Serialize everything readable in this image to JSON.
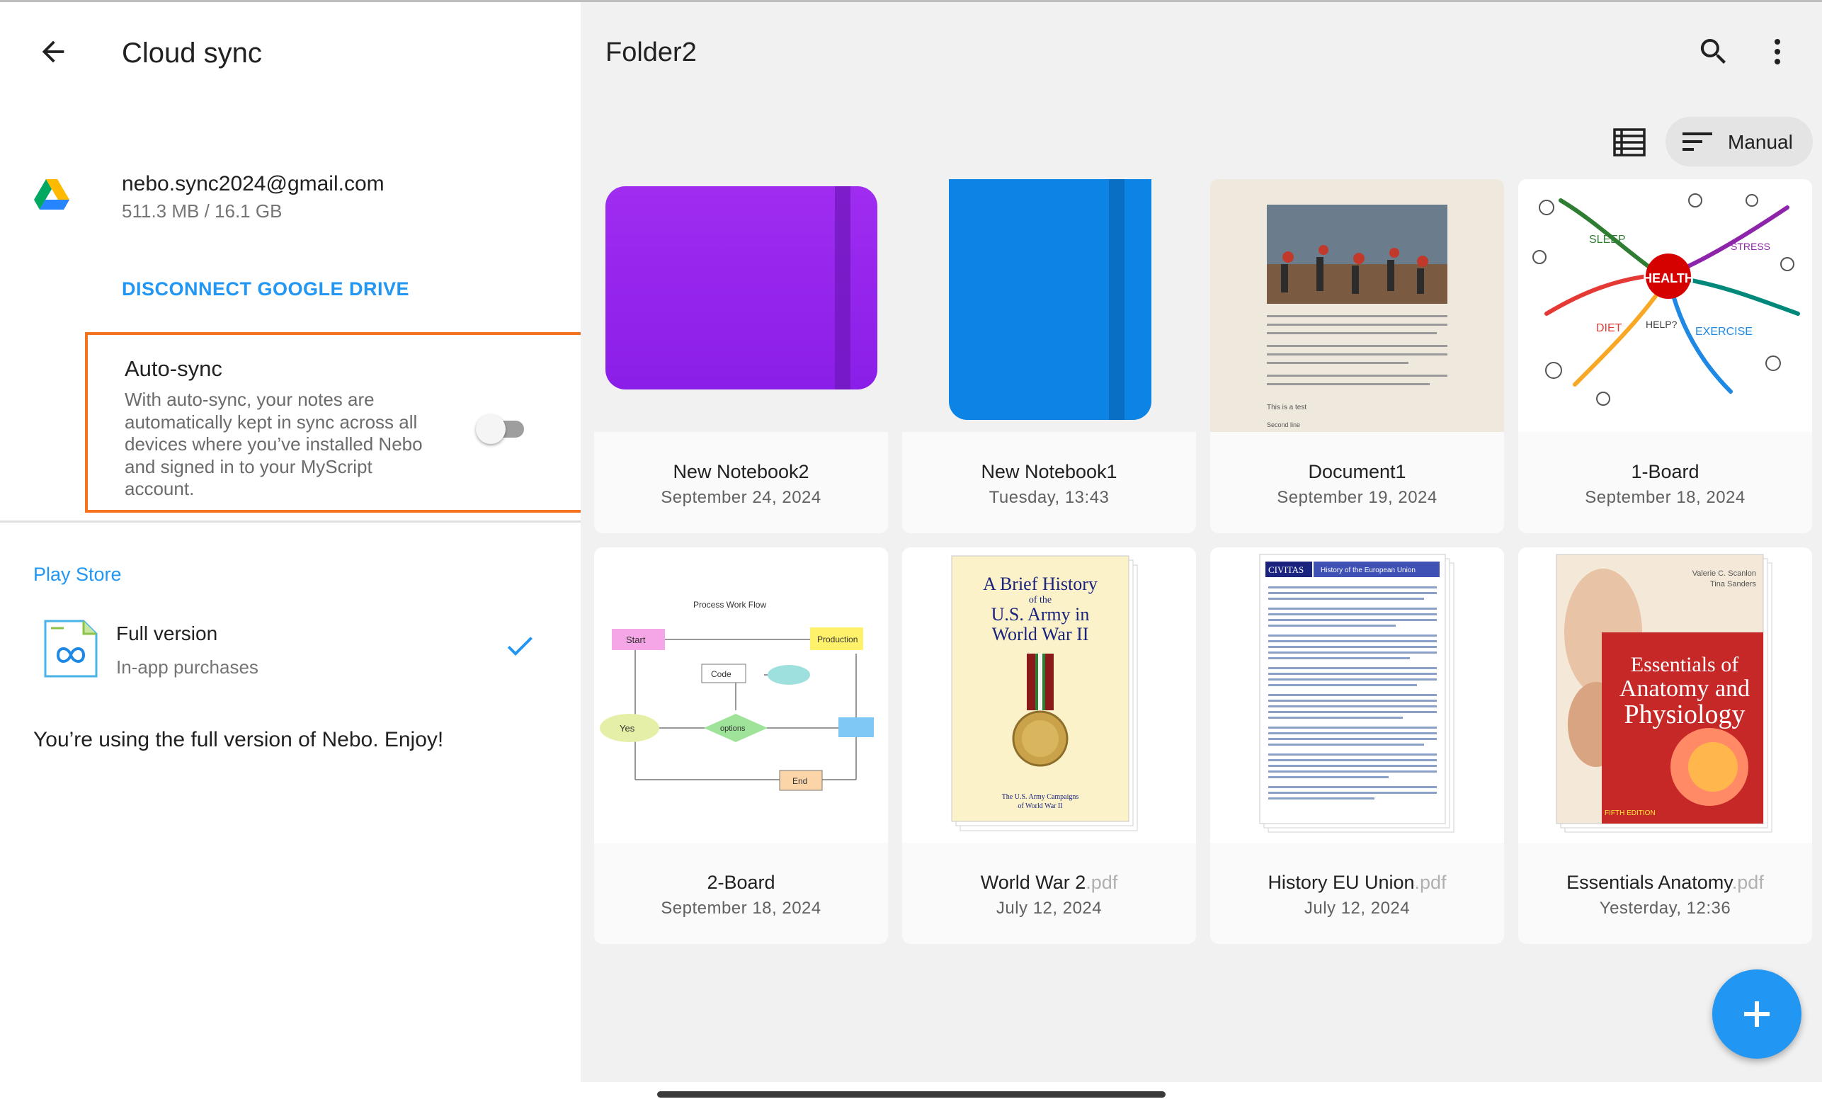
{
  "settings": {
    "title": "Cloud sync",
    "account": {
      "email": "nebo.sync2024@gmail.com",
      "usage": "511.3 MB / 16.1 GB"
    },
    "disconnect_label": "DISCONNECT GOOGLE DRIVE",
    "autosync": {
      "title": "Auto-sync",
      "description": "With auto-sync, your notes are automatically kept in sync across all devices where you’ve installed Nebo and signed in to your MyScript account.",
      "enabled": false
    },
    "store": {
      "heading": "Play Store",
      "item_title": "Full version",
      "item_subtitle": "In-app purchases",
      "message": "You’re using the full version of Nebo. Enjoy!"
    }
  },
  "folder": {
    "title": "Folder2",
    "sort_label": "Manual",
    "items": [
      {
        "name": "New Notebook2",
        "ext": "",
        "date": "September 24, 2024"
      },
      {
        "name": "New Notebook1",
        "ext": "",
        "date": "Tuesday, 13:43"
      },
      {
        "name": "Document1",
        "ext": "",
        "date": "September 19, 2024"
      },
      {
        "name": "1-Board",
        "ext": "",
        "date": "September 18, 2024"
      },
      {
        "name": "2-Board",
        "ext": "",
        "date": "September 18, 2024"
      },
      {
        "name": "World War 2",
        "ext": ".pdf",
        "date": "July 12, 2024"
      },
      {
        "name": "History EU Union",
        "ext": ".pdf",
        "date": "July 12, 2024"
      },
      {
        "name": "Essentials Anatomy",
        "ext": ".pdf",
        "date": "Yesterday, 12:36"
      }
    ],
    "thumbs": {
      "doc_caption": "This is a test",
      "doc_footer": "Second line",
      "board_title": "Process Work Flow",
      "board_nodes": [
        "Start",
        "Production",
        "Code",
        "options",
        "Yes",
        "End"
      ],
      "mindmap_center": "HEALTH",
      "mindmap_labels": [
        "SLEEP",
        "DIET",
        "EXERCISE",
        "HELP?",
        "STRESS"
      ],
      "ww2_title": [
        "A Brief History",
        "of the",
        "U.S. Army in",
        "World War II"
      ],
      "ww2_subtitle": [
        "The U.S. Army Campaigns",
        "of World War II"
      ],
      "eu_brand": "CIVITAS",
      "eu_title": "History of the European Union",
      "anatomy_authors": [
        "Valerie C. Scanlon",
        "Tina Sanders"
      ],
      "anatomy_title": [
        "Essentials of",
        "Anatomy and",
        "Physiology"
      ],
      "anatomy_edition": "FIFTH EDITION"
    }
  },
  "colors": {
    "accent": "#2196f3",
    "highlight": "#f5731f",
    "notebook_purple": "#8a1ee8",
    "notebook_blue": "#0b84e6"
  }
}
